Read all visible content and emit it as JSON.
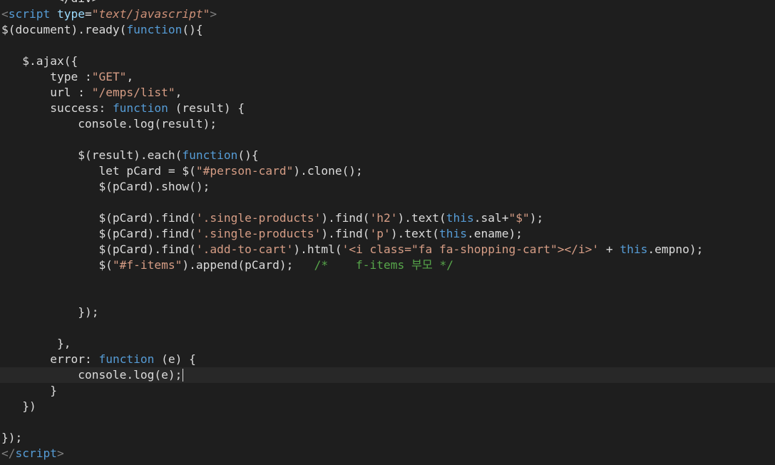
{
  "editor": {
    "theme_colors": {
      "background": "#1e1e1e",
      "current_line": "#282828",
      "plain": "#dcdcdc",
      "keyword": "#569cd6",
      "string": "#d69d85",
      "comment": "#57a64a",
      "html_tag": "#569cd6",
      "html_attribute": "#9cdcfe",
      "html_attribute_value": "#ce9178"
    },
    "caret_line_index": 24,
    "lines": [
      [
        {
          "t": "        </div>",
          "c": "plain"
        }
      ],
      [
        {
          "t": "<",
          "c": "bracket"
        },
        {
          "t": "script",
          "c": "tag"
        },
        {
          "t": " type",
          "c": "attr"
        },
        {
          "t": "=",
          "c": "plain"
        },
        {
          "t": "\"text/javascript\"",
          "c": "attrval"
        },
        {
          "t": ">",
          "c": "bracket"
        }
      ],
      [
        {
          "t": "$(document).ready(",
          "c": "plain"
        },
        {
          "t": "function",
          "c": "keyword"
        },
        {
          "t": "(){",
          "c": "plain"
        }
      ],
      [],
      [
        {
          "t": "   $.ajax({",
          "c": "plain"
        }
      ],
      [
        {
          "t": "       type :",
          "c": "plain"
        },
        {
          "t": "\"GET\"",
          "c": "string"
        },
        {
          "t": ",",
          "c": "plain"
        }
      ],
      [
        {
          "t": "       url : ",
          "c": "plain"
        },
        {
          "t": "\"/emps/list\"",
          "c": "string"
        },
        {
          "t": ",",
          "c": "plain"
        }
      ],
      [
        {
          "t": "       success: ",
          "c": "plain"
        },
        {
          "t": "function",
          "c": "keyword"
        },
        {
          "t": " (result) {",
          "c": "plain"
        }
      ],
      [
        {
          "t": "           console.log(result);",
          "c": "plain"
        }
      ],
      [],
      [
        {
          "t": "           $(result).each(",
          "c": "plain"
        },
        {
          "t": "function",
          "c": "keyword"
        },
        {
          "t": "(){",
          "c": "plain"
        }
      ],
      [
        {
          "t": "              let pCard = $(",
          "c": "plain"
        },
        {
          "t": "\"#person-card\"",
          "c": "string"
        },
        {
          "t": ").clone();",
          "c": "plain"
        }
      ],
      [
        {
          "t": "              $(pCard).show();",
          "c": "plain"
        }
      ],
      [],
      [
        {
          "t": "              $(pCard).find(",
          "c": "plain"
        },
        {
          "t": "'.single-products'",
          "c": "string"
        },
        {
          "t": ").find(",
          "c": "plain"
        },
        {
          "t": "'h2'",
          "c": "string"
        },
        {
          "t": ").text(",
          "c": "plain"
        },
        {
          "t": "this",
          "c": "keyword"
        },
        {
          "t": ".sal+",
          "c": "plain"
        },
        {
          "t": "\"$\"",
          "c": "string"
        },
        {
          "t": ");",
          "c": "plain"
        }
      ],
      [
        {
          "t": "              $(pCard).find(",
          "c": "plain"
        },
        {
          "t": "'.single-products'",
          "c": "string"
        },
        {
          "t": ").find(",
          "c": "plain"
        },
        {
          "t": "'p'",
          "c": "string"
        },
        {
          "t": ").text(",
          "c": "plain"
        },
        {
          "t": "this",
          "c": "keyword"
        },
        {
          "t": ".ename);",
          "c": "plain"
        }
      ],
      [
        {
          "t": "              $(pCard).find(",
          "c": "plain"
        },
        {
          "t": "'.add-to-cart'",
          "c": "string"
        },
        {
          "t": ").html(",
          "c": "plain"
        },
        {
          "t": "'<i class=\"fa fa-shopping-cart\"></i>'",
          "c": "string"
        },
        {
          "t": " + ",
          "c": "plain"
        },
        {
          "t": "this",
          "c": "keyword"
        },
        {
          "t": ".empno);",
          "c": "plain"
        }
      ],
      [
        {
          "t": "              $(",
          "c": "plain"
        },
        {
          "t": "\"#f-items\"",
          "c": "string"
        },
        {
          "t": ").append(pCard);   ",
          "c": "plain"
        },
        {
          "t": "/*    f-items 부모 */",
          "c": "comment"
        }
      ],
      [],
      [],
      [
        {
          "t": "           });",
          "c": "plain"
        }
      ],
      [],
      [
        {
          "t": "        },",
          "c": "plain"
        }
      ],
      [
        {
          "t": "       error: ",
          "c": "plain"
        },
        {
          "t": "function",
          "c": "keyword"
        },
        {
          "t": " (e) {",
          "c": "plain"
        }
      ],
      [
        {
          "t": "           console.log(e);",
          "c": "plain"
        }
      ],
      [
        {
          "t": "       }",
          "c": "plain"
        }
      ],
      [
        {
          "t": "   })",
          "c": "plain"
        }
      ],
      [],
      [
        {
          "t": "});",
          "c": "plain"
        }
      ],
      [
        {
          "t": "</",
          "c": "bracket"
        },
        {
          "t": "script",
          "c": "tag"
        },
        {
          "t": ">",
          "c": "bracket"
        }
      ],
      [
        {
          "t": "                ...................",
          "c": "plain"
        }
      ]
    ]
  }
}
